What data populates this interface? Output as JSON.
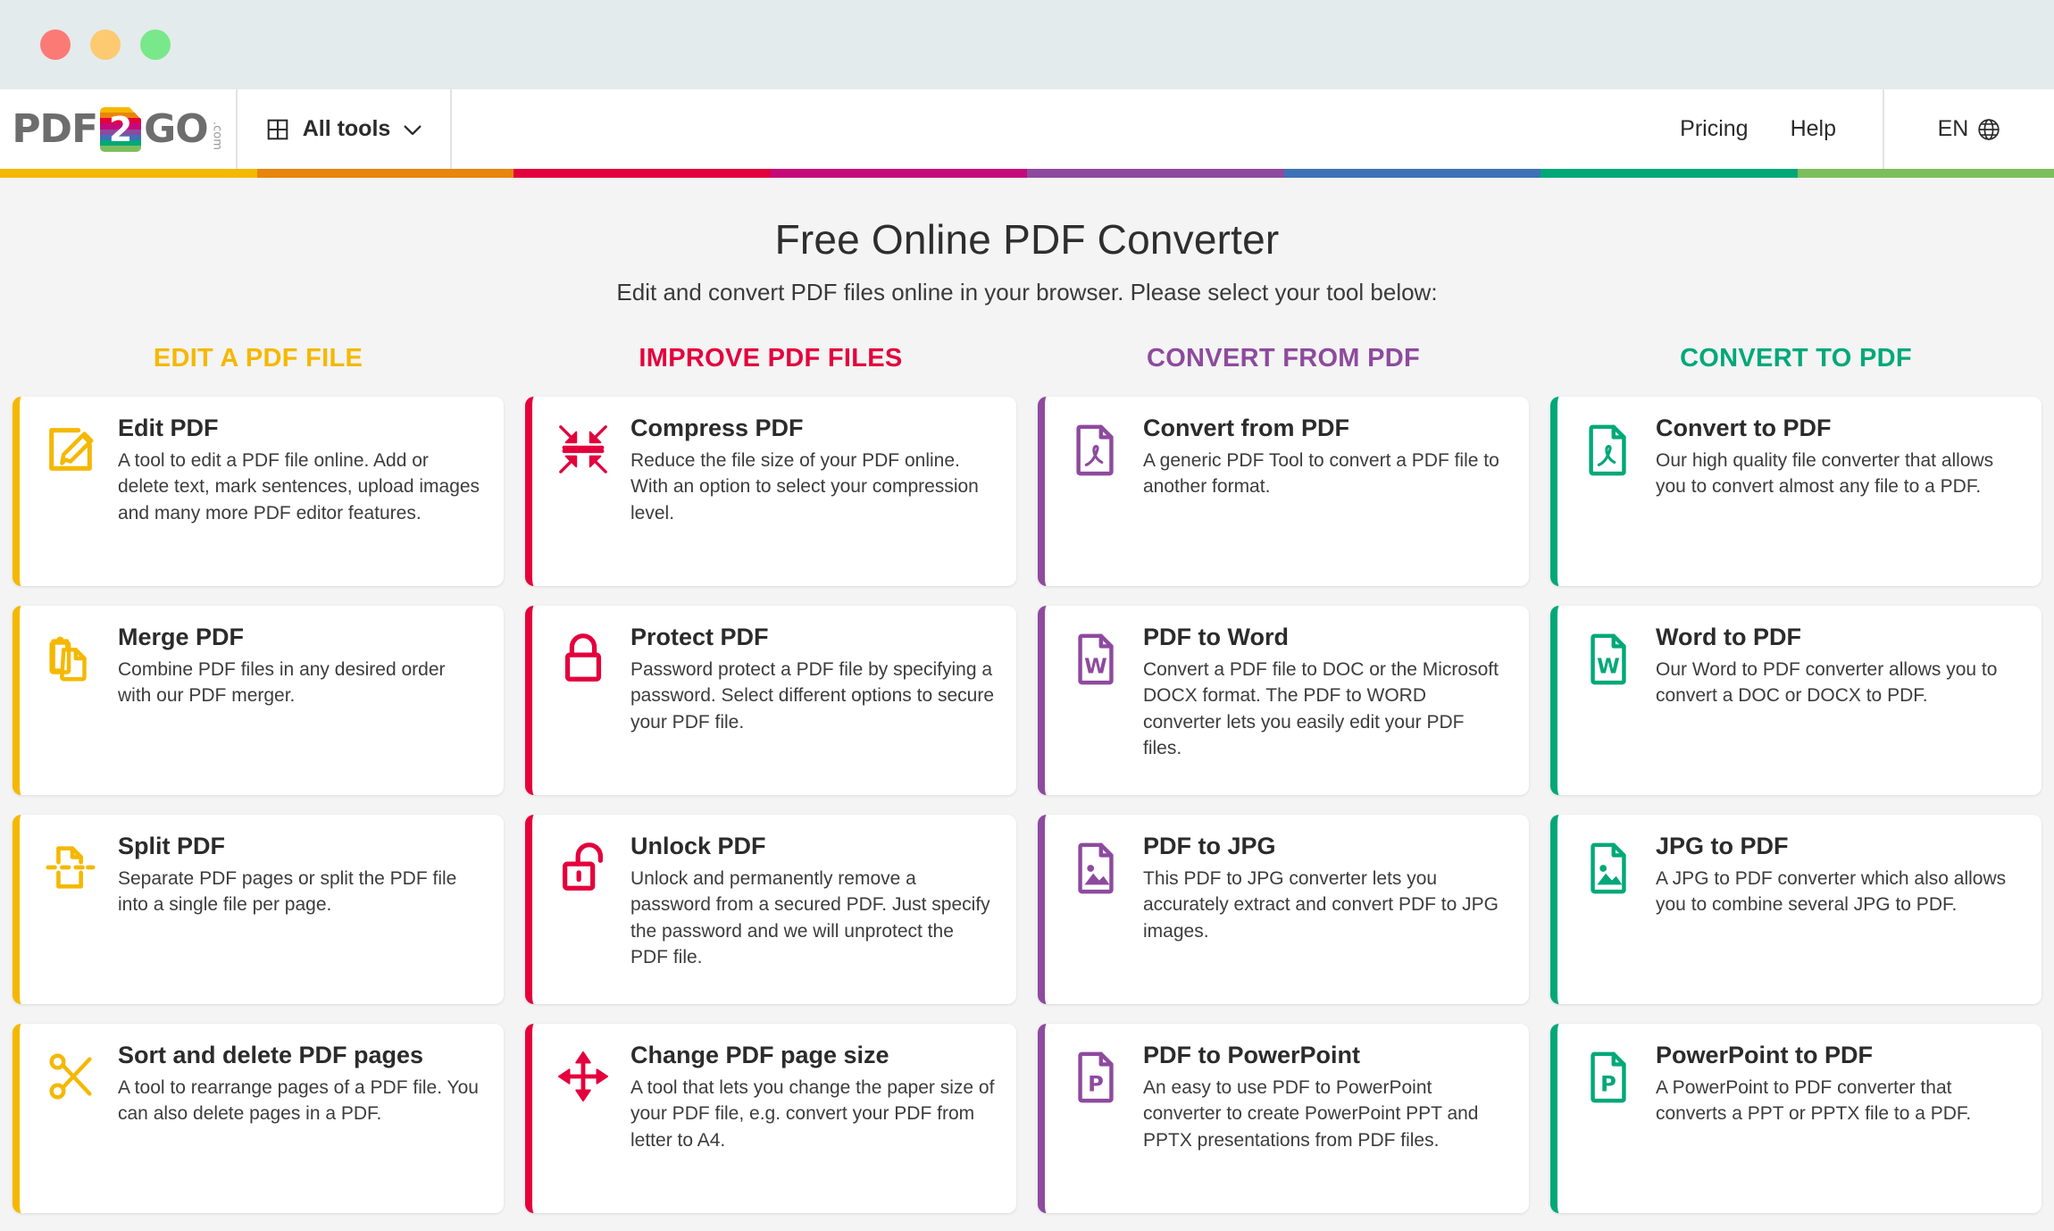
{
  "window": {
    "controls": [
      {
        "name": "close",
        "color": "#FC7A76"
      },
      {
        "name": "minimize",
        "color": "#FDCA71"
      },
      {
        "name": "maximize",
        "color": "#79E88B"
      }
    ]
  },
  "header": {
    "logo": {
      "text_left": "PDF",
      "badge": "2",
      "text_right": "GO",
      "suffix": ".com",
      "badge_stripe_colors": [
        "#F5B800",
        "#E8850C",
        "#E4003C",
        "#C5097A",
        "#8E4A9E",
        "#3E72B8",
        "#00A878",
        "#7DBE5C"
      ]
    },
    "all_tools_label": "All tools",
    "nav": [
      {
        "label": "Pricing"
      },
      {
        "label": "Help"
      }
    ],
    "language": "EN"
  },
  "rainbow_bar": [
    "#F5B800",
    "#E8850C",
    "#E4003C",
    "#C5097A",
    "#8E4A9E",
    "#3E72B8",
    "#00A878",
    "#7DBE5C"
  ],
  "hero": {
    "title": "Free Online PDF Converter",
    "subtitle": "Edit and convert PDF files online in your browser. Please select your tool below:"
  },
  "columns": [
    {
      "heading": "EDIT A PDF FILE",
      "color": "#F5B800",
      "cards": [
        {
          "icon": "edit-pdf-icon",
          "title": "Edit PDF",
          "desc": "A tool to edit a PDF file online. Add or delete text, mark sentences, upload images and many more PDF editor features."
        },
        {
          "icon": "merge-pdf-icon",
          "title": "Merge PDF",
          "desc": "Combine PDF files in any desired order with our PDF merger."
        },
        {
          "icon": "split-pdf-icon",
          "title": "Split PDF",
          "desc": "Separate PDF pages or split the PDF file into a single file per page."
        },
        {
          "icon": "scissors-icon",
          "title": "Sort and delete PDF pages",
          "desc": "A tool to rearrange pages of a PDF file. You can also delete pages in a PDF."
        }
      ]
    },
    {
      "heading": "IMPROVE PDF FILES",
      "color": "#E4003C",
      "cards": [
        {
          "icon": "compress-icon",
          "title": "Compress PDF",
          "desc": "Reduce the file size of your PDF online. With an option to select your compression level."
        },
        {
          "icon": "lock-closed-icon",
          "title": "Protect PDF",
          "desc": "Password protect a PDF file by specifying a password. Select different options to secure your PDF file."
        },
        {
          "icon": "lock-open-icon",
          "title": "Unlock PDF",
          "desc": "Unlock and permanently remove a password from a secured PDF. Just specify the password and we will unprotect the PDF file."
        },
        {
          "icon": "resize-arrows-icon",
          "title": "Change PDF page size",
          "desc": "A tool that lets you change the paper size of your PDF file, e.g. convert your PDF from letter to A4."
        }
      ]
    },
    {
      "heading": "CONVERT FROM PDF",
      "color": "#8E4A9E",
      "cards": [
        {
          "icon": "pdf-document-icon",
          "title": "Convert from PDF",
          "desc": "A generic PDF Tool to convert a PDF file to another format."
        },
        {
          "icon": "word-document-icon",
          "title": "PDF to Word",
          "desc": "Convert a PDF file to DOC or the Microsoft DOCX format. The PDF to WORD converter lets you easily edit your PDF files."
        },
        {
          "icon": "image-document-icon",
          "title": "PDF to JPG",
          "desc": "This PDF to JPG converter lets you accurately extract and convert PDF to JPG images."
        },
        {
          "icon": "powerpoint-document-icon",
          "title": "PDF to PowerPoint",
          "desc": "An easy to use PDF to PowerPoint converter to create PowerPoint PPT and PPTX presentations from PDF files."
        }
      ]
    },
    {
      "heading": "CONVERT TO PDF",
      "color": "#00A878",
      "cards": [
        {
          "icon": "pdf-document-icon",
          "title": "Convert to PDF",
          "desc": "Our high quality file converter that allows you to convert almost any file to a PDF."
        },
        {
          "icon": "word-document-icon",
          "title": "Word to PDF",
          "desc": "Our Word to PDF converter allows you to convert a DOC or DOCX to PDF."
        },
        {
          "icon": "image-document-icon",
          "title": "JPG to PDF",
          "desc": "A JPG to PDF converter which also allows you to combine several JPG to PDF."
        },
        {
          "icon": "powerpoint-document-icon",
          "title": "PowerPoint to PDF",
          "desc": "A PowerPoint to PDF converter that converts a PPT or PPTX file to a PDF."
        }
      ]
    }
  ]
}
